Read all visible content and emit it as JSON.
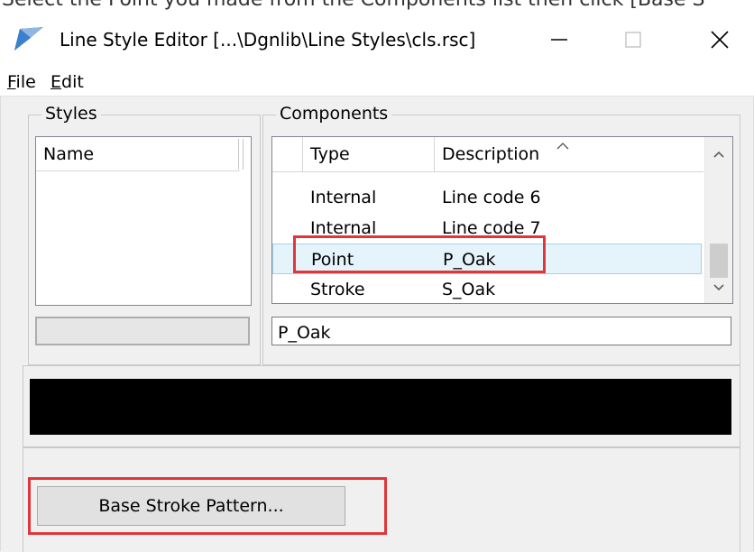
{
  "doc_text": "Select the Point you made from the Components list then click [Base S",
  "window": {
    "title": "Line Style Editor [...\\Dgnlib\\Line Styles\\cls.rsc]"
  },
  "menu": {
    "file": {
      "u": "F",
      "rest": "ile"
    },
    "edit": {
      "u": "E",
      "rest": "dit"
    }
  },
  "styles": {
    "label": "Styles",
    "col_name": "Name"
  },
  "components": {
    "label": "Components",
    "col_type": "Type",
    "col_description": "Description",
    "rows": [
      {
        "type": "Internal",
        "description": "Line code 6"
      },
      {
        "type": "Internal",
        "description": "Line code 7"
      },
      {
        "type": "Point",
        "description": "P_Oak"
      },
      {
        "type": "Stroke",
        "description": "S_Oak"
      }
    ],
    "name_value": "P_Oak"
  },
  "button": {
    "base_stroke": "Base Stroke Pattern..."
  },
  "colors": {
    "highlight": "#e0363a",
    "selection": "#e5f3fb",
    "preview": "#000000"
  }
}
